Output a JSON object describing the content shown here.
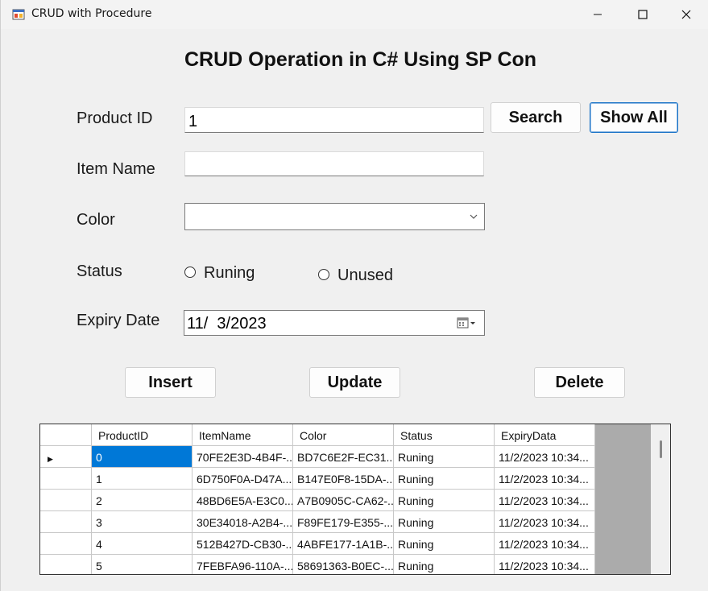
{
  "window": {
    "title": "CRUD with Procedure",
    "minimize_glyph": "—",
    "maximize_glyph": "☐",
    "close_glyph": "✕"
  },
  "form": {
    "heading": "CRUD Operation in C# Using SP Con",
    "product_id_label": "Product ID",
    "product_id_value": "1",
    "item_name_label": "Item Name",
    "item_name_value": "",
    "color_label": "Color",
    "color_value": "",
    "status_label": "Status",
    "status_options": [
      "Runing",
      "Unused"
    ],
    "expiry_label": "Expiry Date",
    "expiry_value": "11/  3/2023"
  },
  "buttons": {
    "search": "Search",
    "show_all": "Show All",
    "insert": "Insert",
    "update": "Update",
    "delete": "Delete"
  },
  "grid": {
    "columns": [
      "ProductID",
      "ItemName",
      "Color",
      "Status",
      "ExpiryData"
    ],
    "rows": [
      [
        "0",
        "70FE2E3D-4B4F-...",
        "BD7C6E2F-EC31...",
        "Runing",
        "11/2/2023 10:34..."
      ],
      [
        "1",
        "6D750F0A-D47A...",
        "B147E0F8-15DA-...",
        "Runing",
        "11/2/2023 10:34..."
      ],
      [
        "2",
        "48BD6E5A-E3C0...",
        "A7B0905C-CA62-...",
        "Runing",
        "11/2/2023 10:34..."
      ],
      [
        "3",
        "30E34018-A2B4-...",
        "F89FE179-E355-...",
        "Runing",
        "11/2/2023 10:34..."
      ],
      [
        "4",
        "512B427D-CB30-...",
        "4ABFE177-1A1B-...",
        "Runing",
        "11/2/2023 10:34..."
      ],
      [
        "5",
        "7FEBFA96-110A-...",
        "58691363-B0EC-...",
        "Runing",
        "11/2/2023 10:34..."
      ]
    ],
    "selected_row": 0,
    "current_row_indicator": "▶"
  },
  "colors": {
    "selection": "#0078d7",
    "focus_border": "#1a73c7",
    "grid_background": "#ababab"
  }
}
